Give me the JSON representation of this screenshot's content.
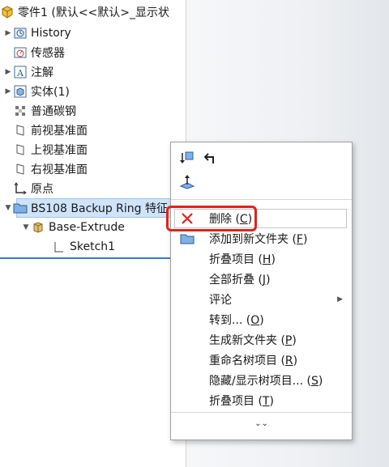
{
  "tree": {
    "root_label": "零件1 (默认<<默认>_显示状",
    "items": [
      {
        "label": "History",
        "icon": "history-icon",
        "expandable": true
      },
      {
        "label": "传感器",
        "icon": "sensor-icon",
        "expandable": false
      },
      {
        "label": "注解",
        "icon": "annotation-icon",
        "expandable": true
      },
      {
        "label": "实体(1)",
        "icon": "solid-body-icon",
        "expandable": true
      },
      {
        "label": "普通碳钢",
        "icon": "material-icon",
        "expandable": false
      },
      {
        "label": "前视基准面",
        "icon": "plane-icon",
        "expandable": false
      },
      {
        "label": "上视基准面",
        "icon": "plane-icon",
        "expandable": false
      },
      {
        "label": "右视基准面",
        "icon": "plane-icon",
        "expandable": false
      },
      {
        "label": "原点",
        "icon": "origin-icon",
        "expandable": false
      },
      {
        "label": "BS108 Backup Ring 特征",
        "icon": "folder-icon",
        "expandable": true
      },
      {
        "label": "Base-Extrude",
        "icon": "extrude-icon",
        "expandable": true
      },
      {
        "label": "Sketch1",
        "icon": "sketch-icon",
        "expandable": false
      }
    ]
  },
  "context_menu": {
    "items": [
      {
        "label": "删除 (C)",
        "text": "删除 (",
        "key": "C",
        "tail": ")",
        "icon": "delete-icon"
      },
      {
        "label": "添加到新文件夹 (F)",
        "text": "添加到新文件夹 (",
        "key": "F",
        "tail": ")",
        "icon": "folder-icon"
      },
      {
        "label": "折叠项目 (H)",
        "text": "折叠项目 (",
        "key": "H",
        "tail": ")",
        "icon": ""
      },
      {
        "label": "全部折叠 (J)",
        "text": "全部折叠 (",
        "key": "J",
        "tail": ")",
        "icon": ""
      },
      {
        "label": "评论",
        "text": "评论",
        "key": "",
        "tail": "",
        "icon": "",
        "submenu": true
      },
      {
        "label": "转到... (O)",
        "text": "转到... (",
        "key": "O",
        "tail": ")",
        "icon": ""
      },
      {
        "label": "生成新文件夹 (P)",
        "text": "生成新文件夹 (",
        "key": "P",
        "tail": ")",
        "icon": ""
      },
      {
        "label": "重命名树项目 (R)",
        "text": "重命名树项目 (",
        "key": "R",
        "tail": ")",
        "icon": ""
      },
      {
        "label": "隐藏/显示树项目... (S)",
        "text": "隐藏/显示树项目... (",
        "key": "S",
        "tail": ")",
        "icon": ""
      },
      {
        "label": "折叠项目 (T)",
        "text": "折叠项目 (",
        "key": "T",
        "tail": ")",
        "icon": ""
      }
    ],
    "more_symbol": "⌄⌄",
    "toolbar_icons": [
      "move-down-icon",
      "back-arrow-icon",
      "normal-to-icon"
    ],
    "highlight_color": "#e0231b"
  }
}
